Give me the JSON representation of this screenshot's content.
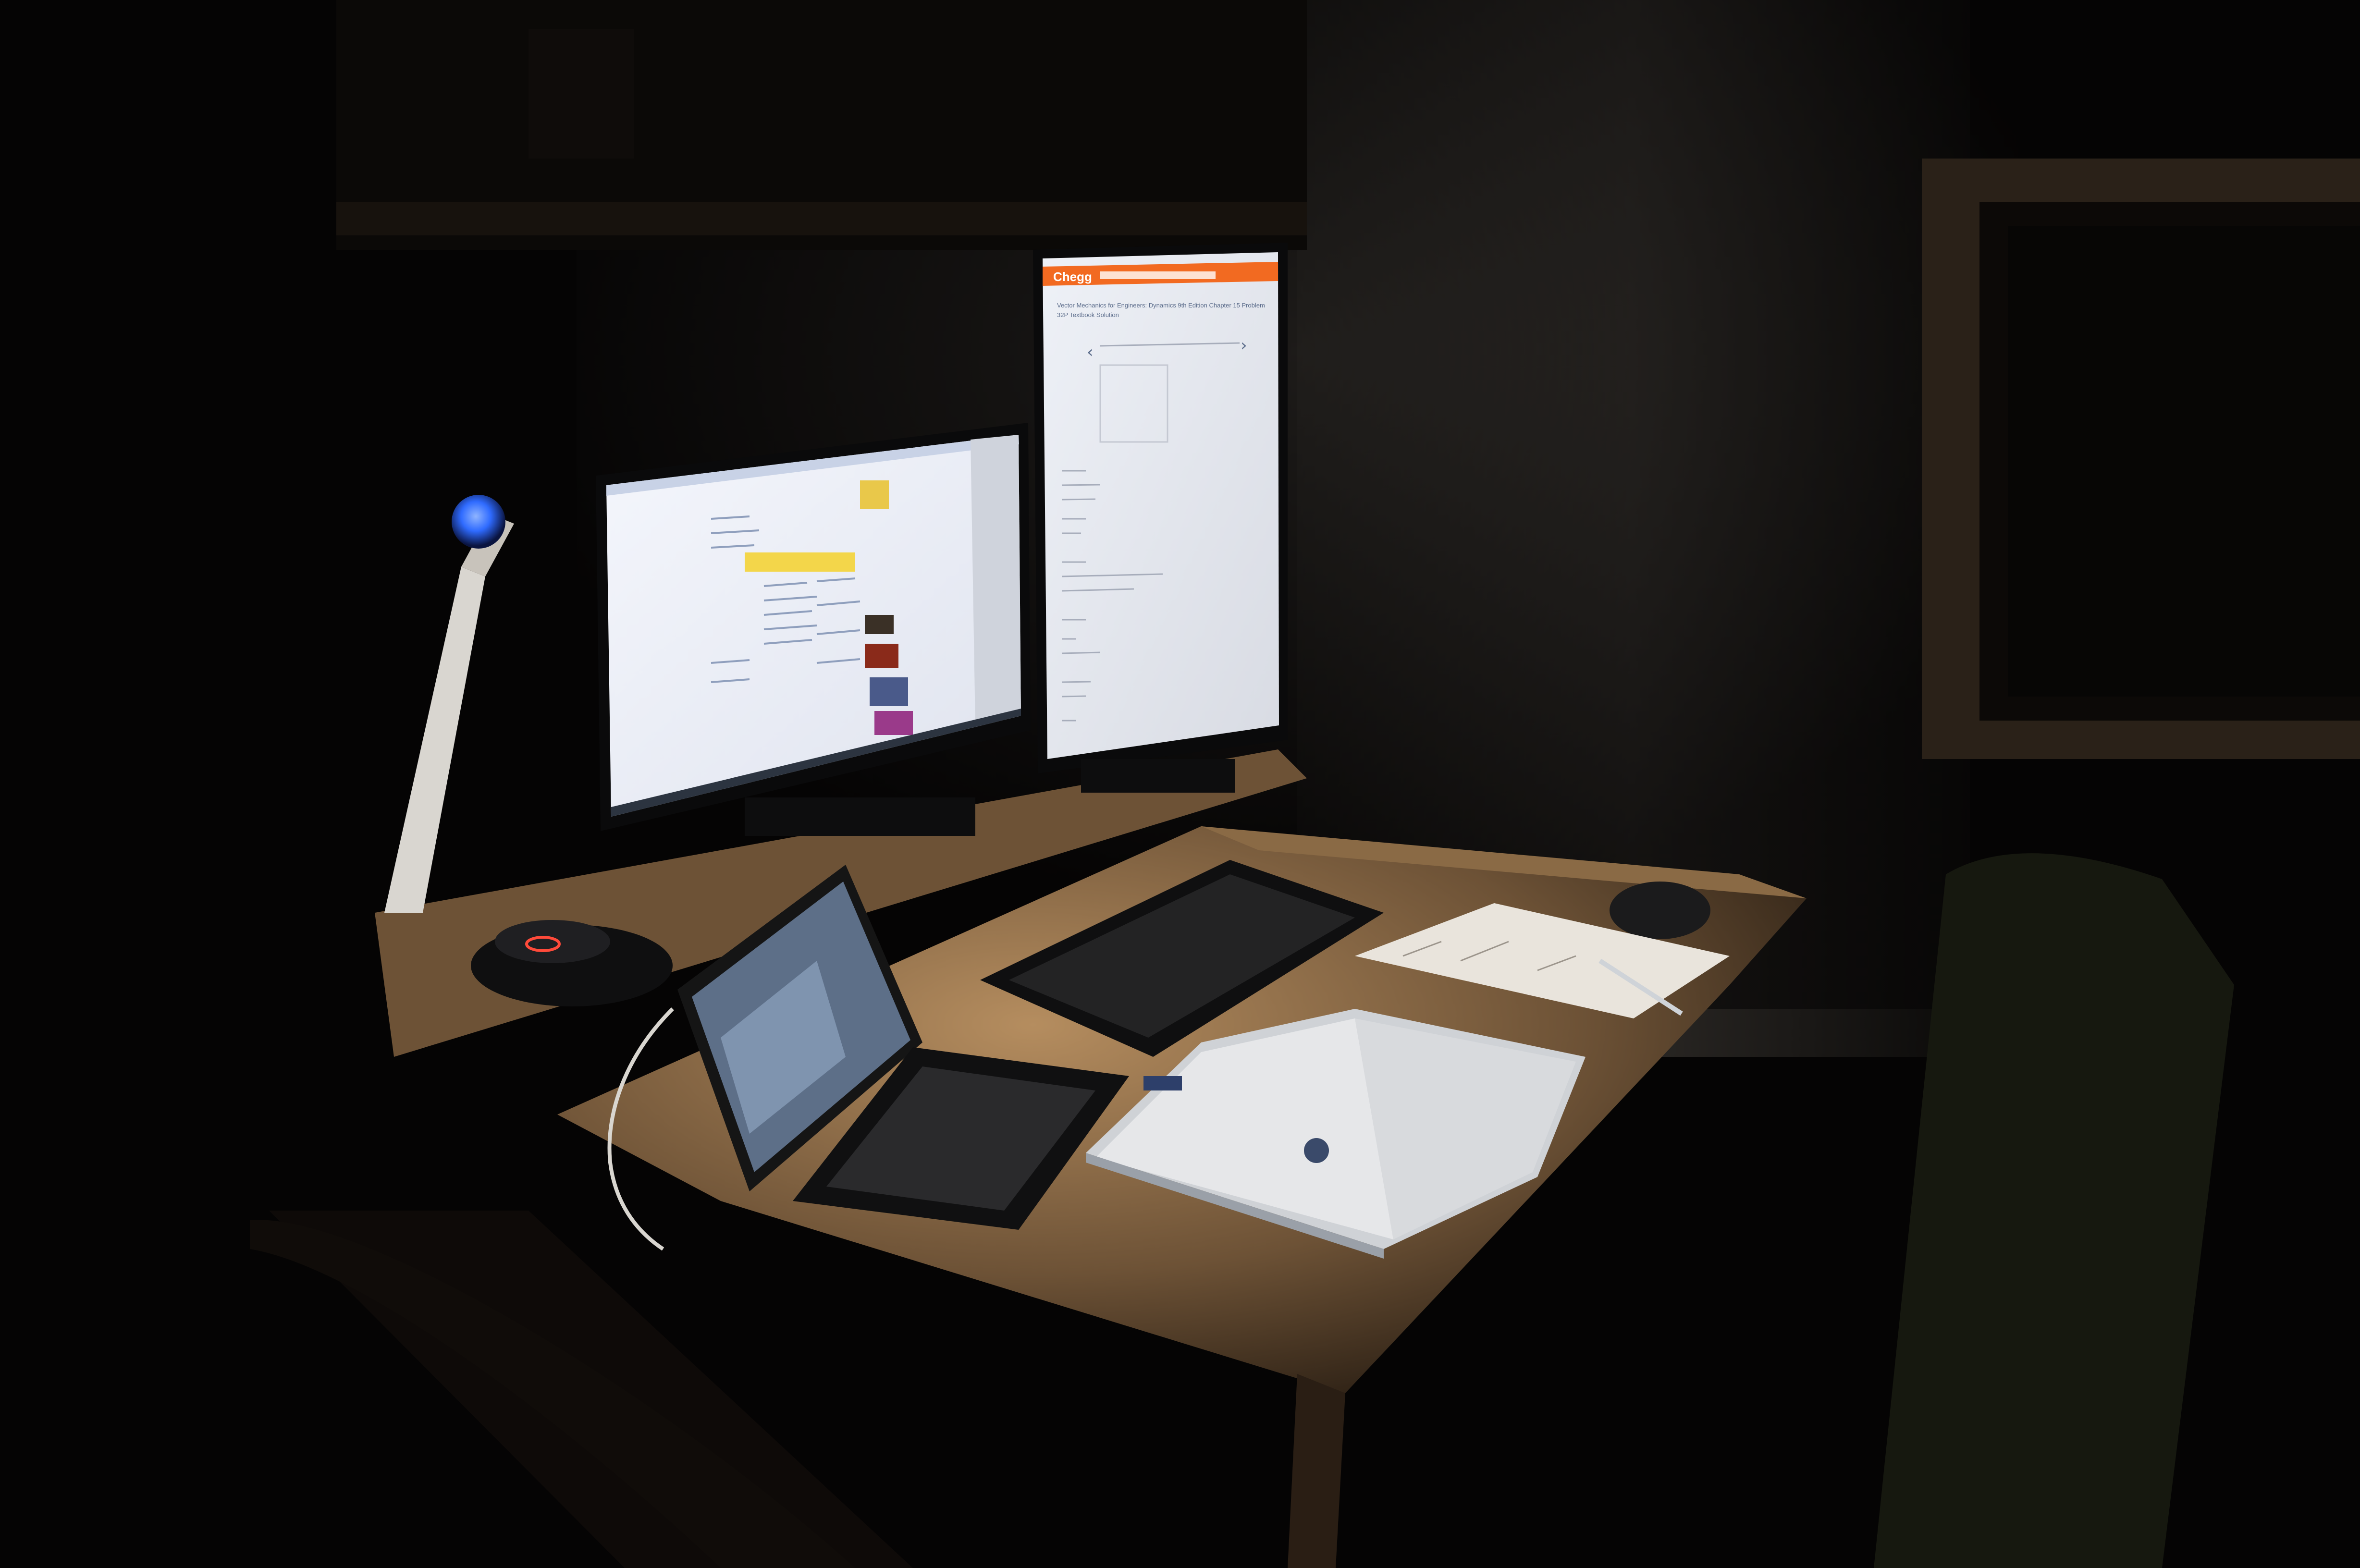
{
  "scene": {
    "kind": "photo-dark-room-desk",
    "objects": [
      "desk-lamp",
      "landscape-monitor",
      "portrait-monitor",
      "tablet-with-keyboard-cover",
      "wireless-keyboard",
      "computer-mouse",
      "textbook",
      "notebook",
      "pen",
      "chair"
    ]
  },
  "right_monitor": {
    "logo": "Chegg",
    "page_title_line1": "Vector Mechanics for Engineers: Dynamics 9th Edition Chapter 15 Problem",
    "page_title_line2": "32P Textbook Solution"
  },
  "colors": {
    "chegg_orange": "#f26a21",
    "lamp_blue": "#2f6bff",
    "lamp_ring_red": "#ff4a3a",
    "desk_wood": "#b08858",
    "screen_white": "#f2f4fb"
  }
}
